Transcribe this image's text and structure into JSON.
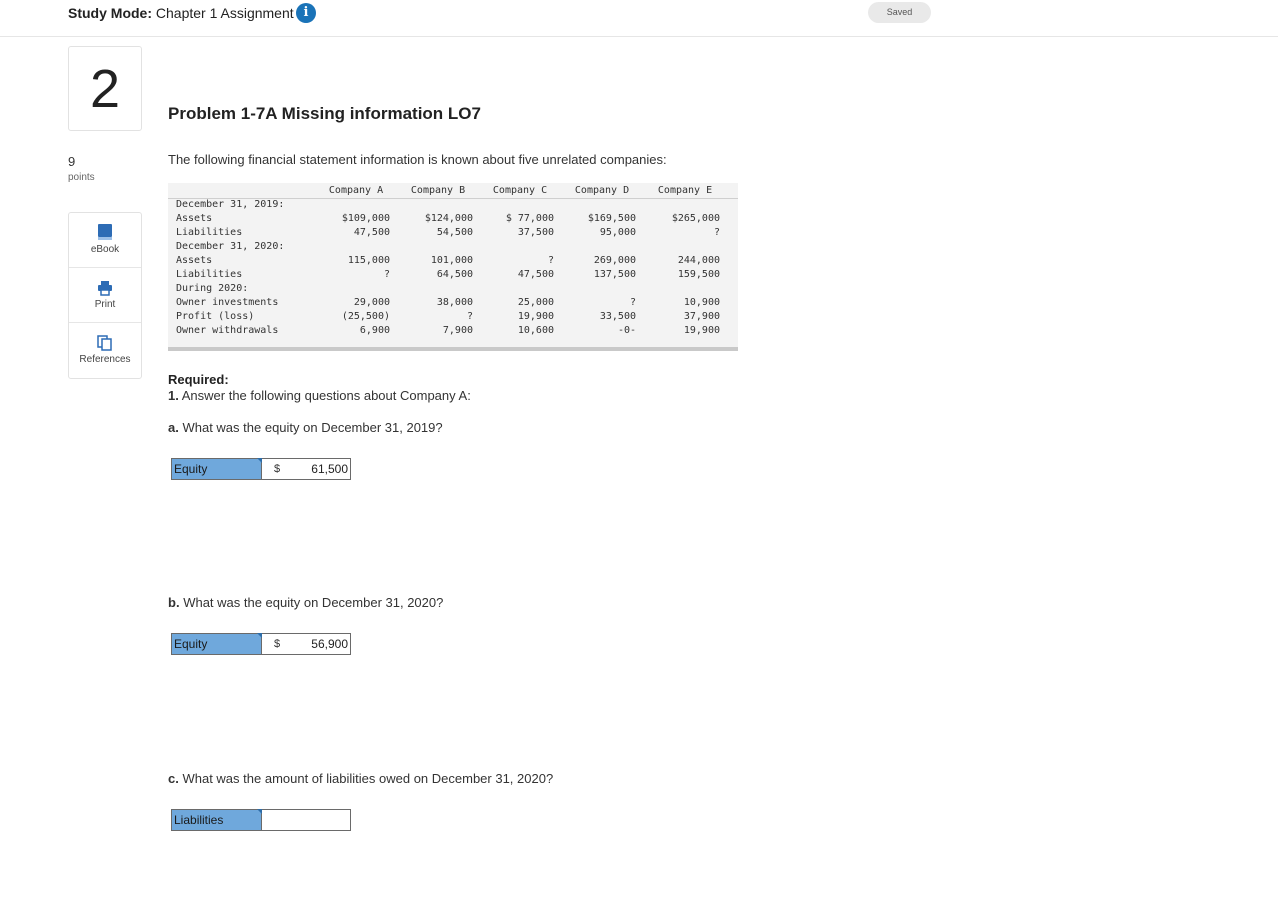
{
  "header": {
    "mode_label": "Study Mode:",
    "assignment_title": "Chapter 1 Assignment",
    "saved_status": "Saved"
  },
  "left_rail": {
    "question_number": "2",
    "points_value": "9",
    "points_label": "points",
    "tools": [
      {
        "label": "eBook",
        "icon": "book-icon"
      },
      {
        "label": "Print",
        "icon": "printer-icon"
      },
      {
        "label": "References",
        "icon": "copy-icon"
      }
    ]
  },
  "problem": {
    "title": "Problem 1-7A Missing information LO7",
    "intro": "The following financial statement information is known about five unrelated companies:"
  },
  "financial_table": {
    "columns": [
      "Company A",
      "Company B",
      "Company C",
      "Company D",
      "Company E"
    ],
    "rows": [
      {
        "label": "December 31, 2019:",
        "values": [
          "",
          "",
          "",
          "",
          ""
        ]
      },
      {
        "label": "Assets",
        "values": [
          "$109,000",
          "$124,000",
          "$ 77,000",
          "$169,500",
          "$265,000"
        ]
      },
      {
        "label": "Liabilities",
        "values": [
          "47,500",
          "54,500",
          "37,500",
          "95,000",
          "?"
        ]
      },
      {
        "label": "December 31, 2020:",
        "values": [
          "",
          "",
          "",
          "",
          ""
        ]
      },
      {
        "label": "Assets",
        "values": [
          "115,000",
          "101,000",
          "?",
          "269,000",
          "244,000"
        ]
      },
      {
        "label": "Liabilities",
        "values": [
          "?",
          "64,500",
          "47,500",
          "137,500",
          "159,500"
        ]
      },
      {
        "label": "During 2020:",
        "values": [
          "",
          "",
          "",
          "",
          ""
        ]
      },
      {
        "label": "Owner investments",
        "values": [
          "29,000",
          "38,000",
          "25,000",
          "?",
          "10,900"
        ]
      },
      {
        "label": "Profit (loss)",
        "values": [
          "(25,500)",
          "?",
          "19,900",
          "33,500",
          "37,900"
        ]
      },
      {
        "label": "Owner withdrawals",
        "values": [
          "6,900",
          "7,900",
          "10,600",
          "-0-",
          "19,900"
        ]
      }
    ]
  },
  "required": {
    "title": "Required:",
    "item_number": "1.",
    "item_text": "Answer the following questions about Company A:"
  },
  "questions": [
    {
      "letter": "a.",
      "text": "What was the equity on December 31, 2019?",
      "field_label": "Equity",
      "currency": "$",
      "value": "61,500"
    },
    {
      "letter": "b.",
      "text": "What was the equity on December 31, 2020?",
      "field_label": "Equity",
      "currency": "$",
      "value": "56,900"
    },
    {
      "letter": "c.",
      "text": "What was the amount of liabilities owed on December 31, 2020?",
      "field_label": "Liabilities",
      "currency": "",
      "value": ""
    }
  ],
  "colors": {
    "accent_blue": "#1a73b8",
    "answer_label_bg": "#6fa8dc",
    "table_bg": "#f3f3f3"
  }
}
